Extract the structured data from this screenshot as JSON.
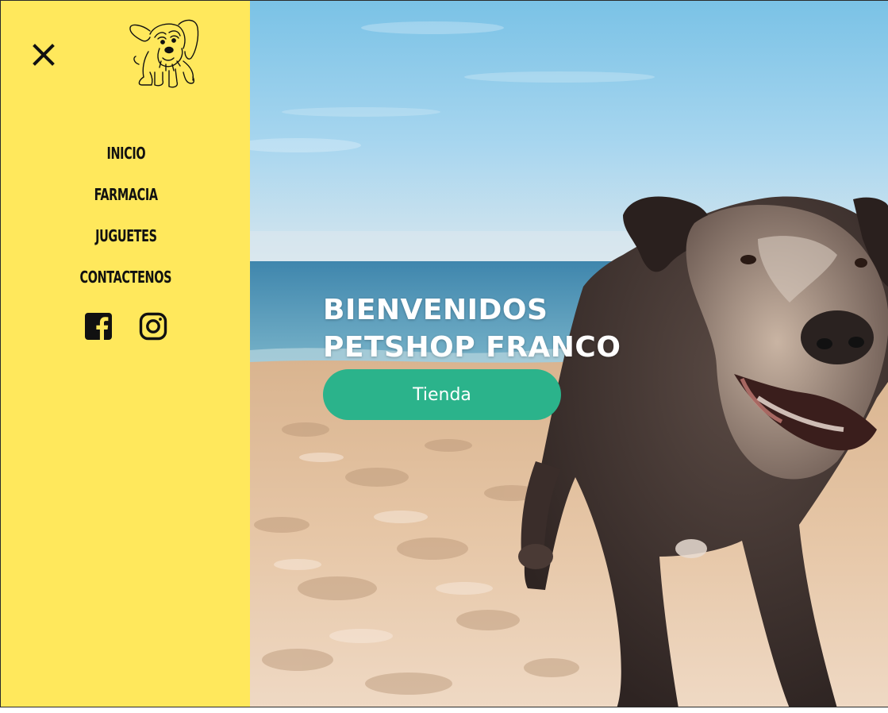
{
  "sidebar": {
    "close_icon": "close-icon",
    "logo_icon": "dog-logo-icon",
    "nav": [
      {
        "label": "INICIO"
      },
      {
        "label": "FARMACIA"
      },
      {
        "label": "JUGUETES"
      },
      {
        "label": "CONTACTENOS"
      }
    ],
    "social": [
      {
        "icon": "facebook-icon"
      },
      {
        "icon": "instagram-icon"
      }
    ]
  },
  "hero": {
    "title_line1": "BIENVENIDOS",
    "title_line2": "PETSHOP FRANCO",
    "button_label": "Tienda"
  },
  "colors": {
    "sidebar_bg": "#ffe85c",
    "button_bg": "#2bb38b",
    "text_dark": "#111111",
    "hero_text": "#ffffff"
  }
}
